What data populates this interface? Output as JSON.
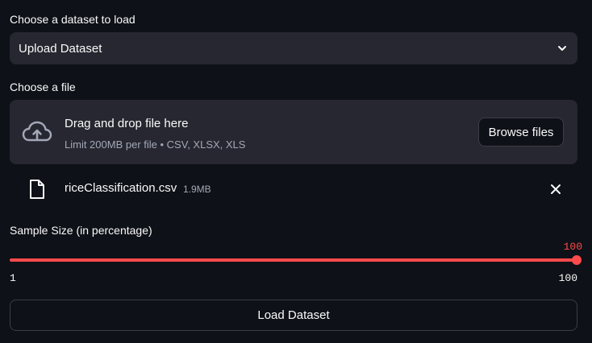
{
  "dataset_select": {
    "label": "Choose a dataset to load",
    "value": "Upload Dataset",
    "icon": "chevron-down-icon"
  },
  "file_uploader": {
    "label": "Choose a file",
    "title": "Drag and drop file here",
    "subtitle": "Limit 200MB per file • CSV, XLSX, XLS",
    "browse_label": "Browse files",
    "icon": "cloud-upload-icon"
  },
  "uploaded_file": {
    "name": "riceClassification.csv",
    "size": "1.9MB",
    "icon": "file-icon",
    "remove_icon": "close-icon"
  },
  "sample_slider": {
    "label": "Sample Size (in percentage)",
    "value": 100,
    "value_text": "100",
    "min": 1,
    "max": 100,
    "min_text": "1",
    "max_text": "100"
  },
  "load_button": {
    "label": "Load Dataset"
  },
  "colors": {
    "background": "#0e1117",
    "widget": "#262730",
    "accent": "#ff4b4b",
    "text": "#fafafa",
    "muted": "#a3a8b8"
  }
}
